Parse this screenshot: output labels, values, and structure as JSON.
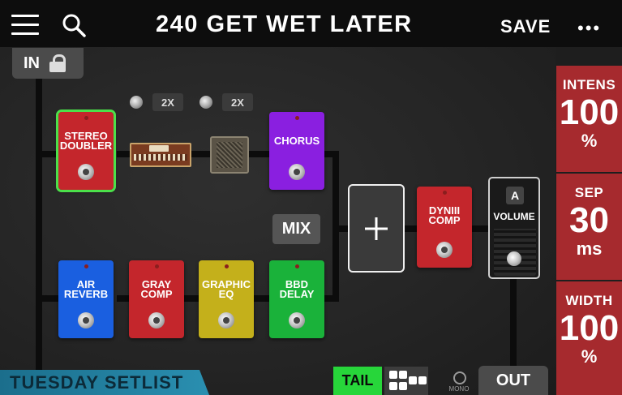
{
  "header": {
    "title": "240 GET WET LATER",
    "save_label": "SAVE",
    "more_label": "•••"
  },
  "routing": {
    "in_label": "IN",
    "out_label": "OUT",
    "mix_label": "MIX",
    "add_label": "+"
  },
  "path_a": {
    "blocks": [
      {
        "label": "STEREO DOUBLER",
        "color": "#c4262c",
        "selected": true
      },
      {
        "label": "CHORUS",
        "color": "#8a1fe0",
        "selected": false
      }
    ],
    "amp_badge": "2X",
    "cab_badge": "2X"
  },
  "path_b": {
    "blocks": [
      {
        "label": "AIR REVERB",
        "color": "#1a5fe0"
      },
      {
        "label": "GRAY COMP",
        "color": "#c4262c"
      },
      {
        "label": "GRAPHIC EQ",
        "color": "#c4b01b"
      },
      {
        "label": "BBD DELAY",
        "color": "#1ab23a"
      }
    ]
  },
  "post": {
    "comp_label": "DYNIII COMP",
    "volume_label": "VOLUME",
    "volume_tag": "A"
  },
  "params": [
    {
      "name": "INTENS",
      "value": "100",
      "unit": "%"
    },
    {
      "name": "SEP",
      "value": "30",
      "unit": "ms"
    },
    {
      "name": "WIDTH",
      "value": "100",
      "unit": "%"
    }
  ],
  "footer": {
    "setlist": "TUESDAY SETLIST",
    "tail_label": "TAIL",
    "mono_label": "MONO"
  },
  "colors": {
    "selected_outline": "#4be14a",
    "param_bg": "#a62a2e",
    "tail_green": "#27d63a",
    "setlist_teal": "#2a8fb0"
  },
  "icons": [
    "hamburger-icon",
    "search-icon",
    "lock-icon",
    "grid-view-icon"
  ]
}
